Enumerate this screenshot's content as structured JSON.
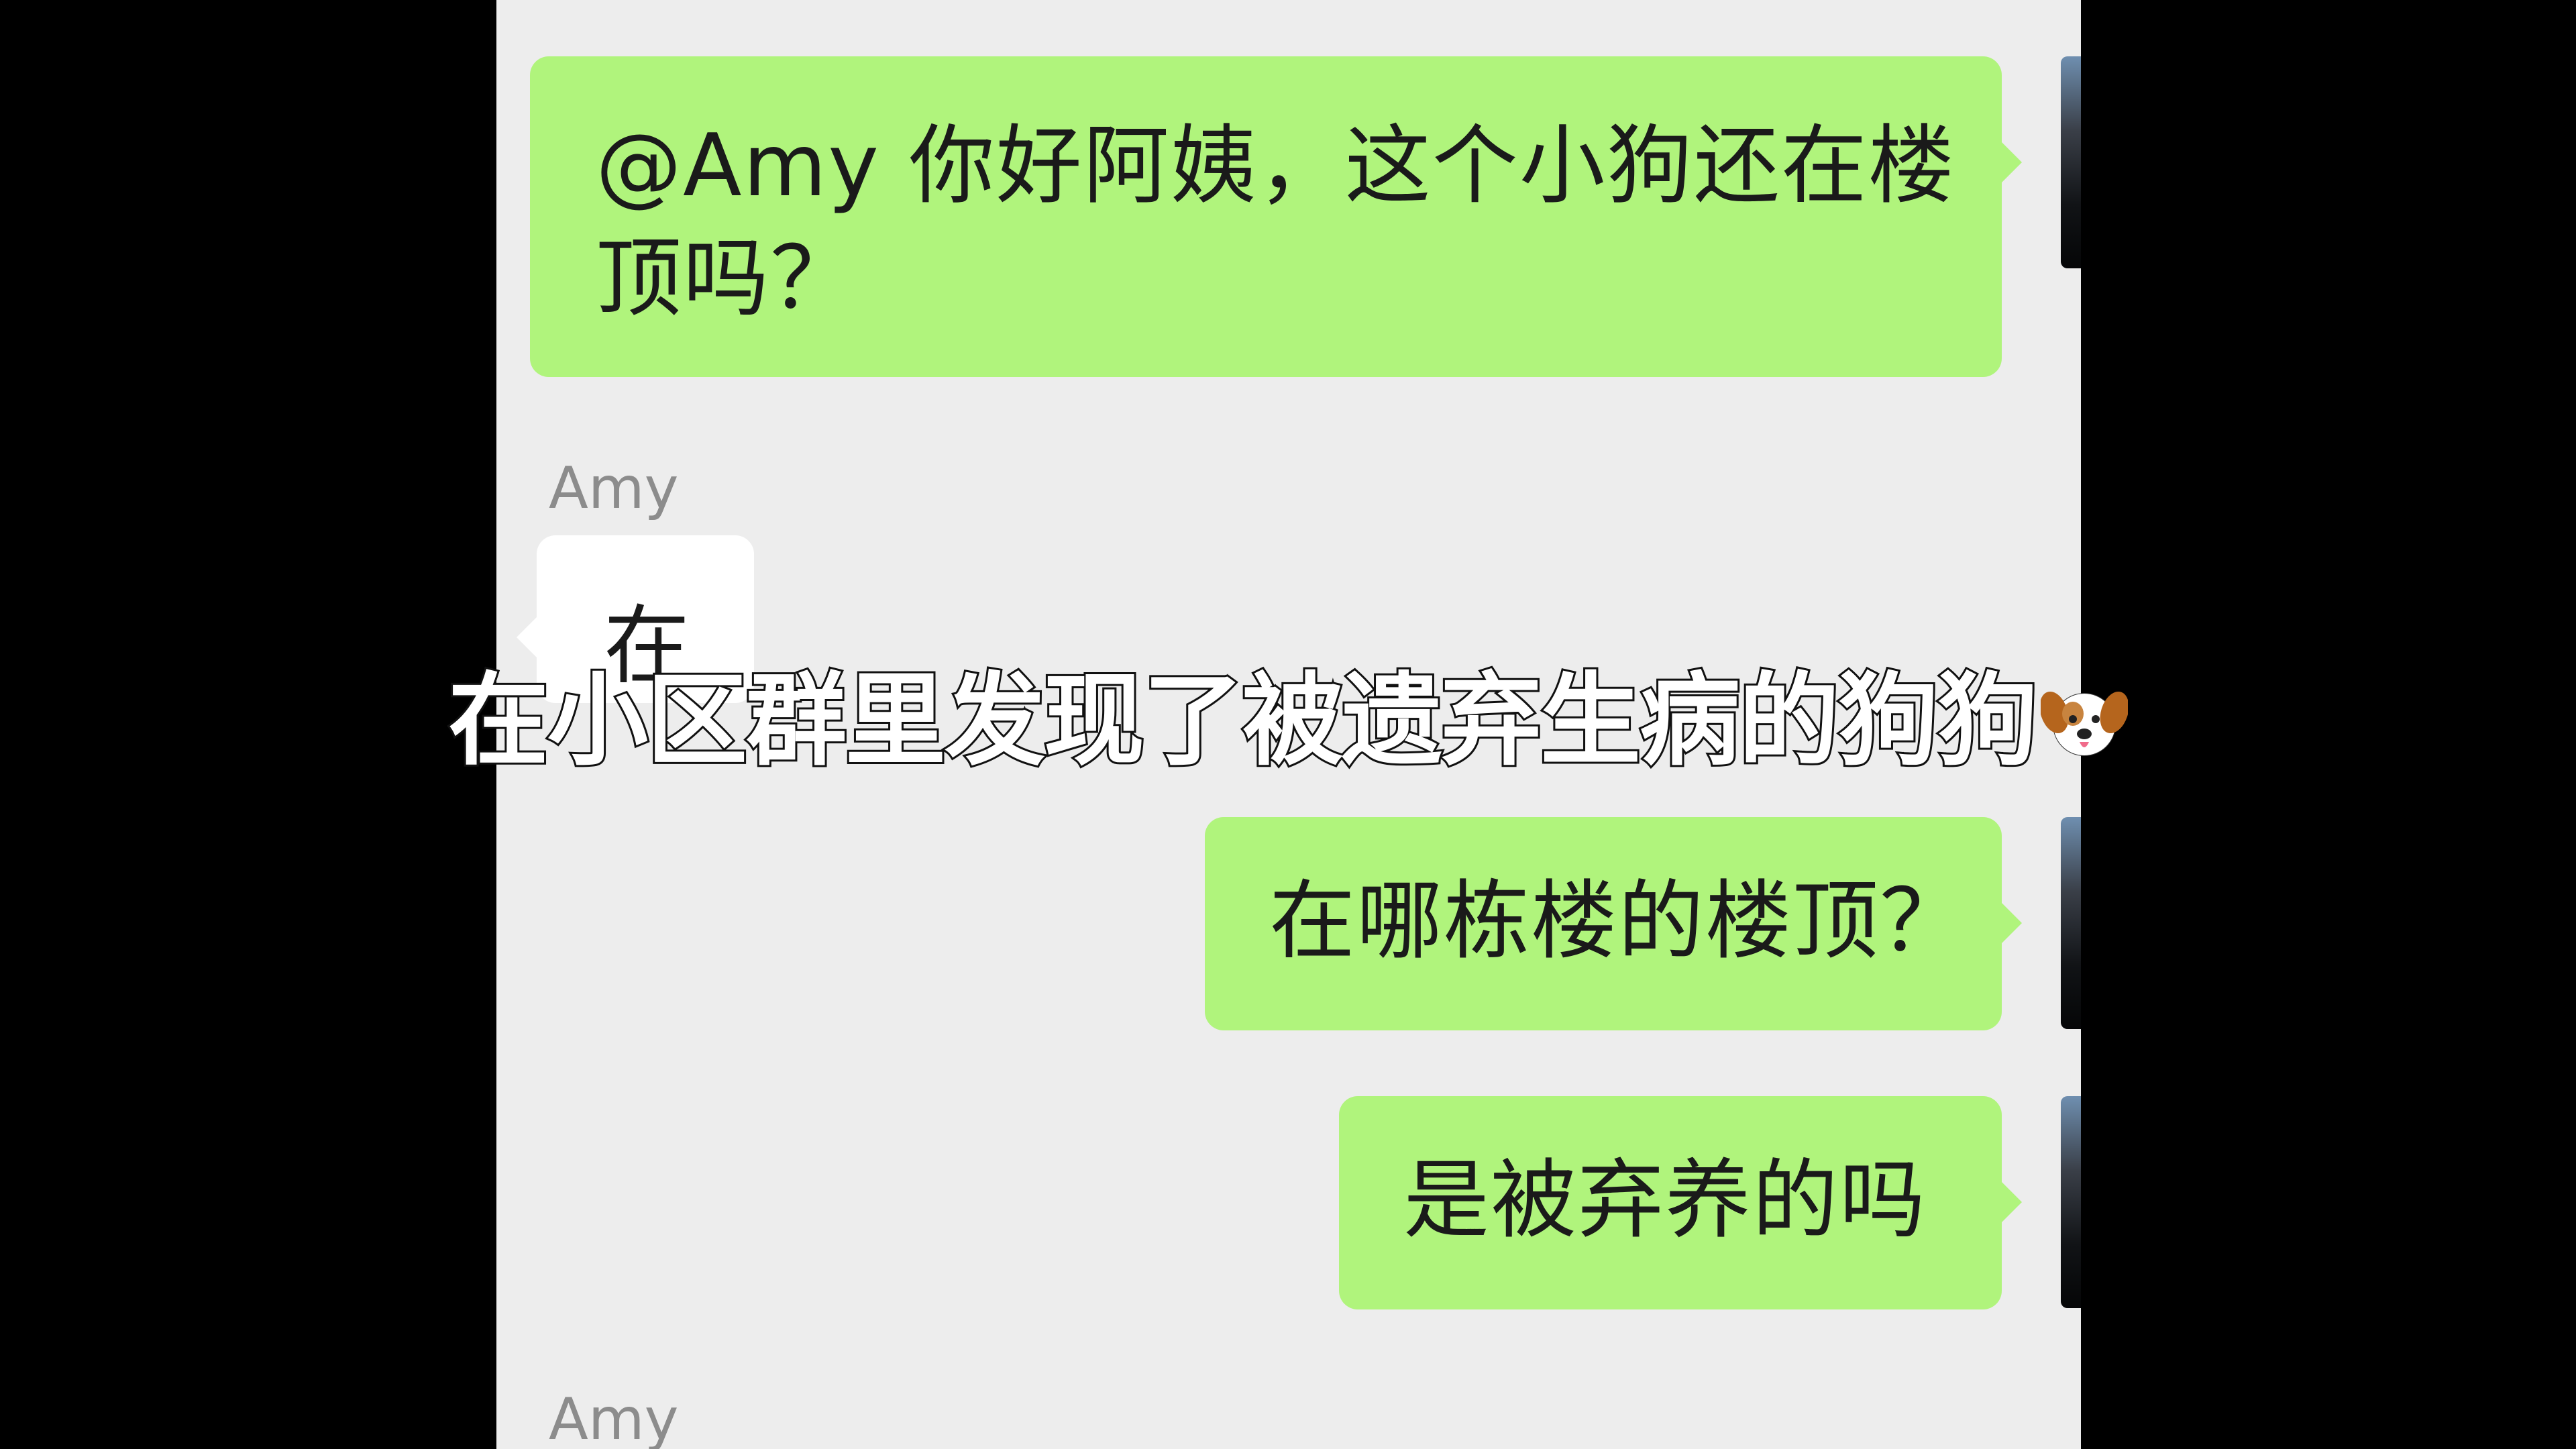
{
  "chat": {
    "messages": [
      {
        "sender": "me",
        "text_line1": "@Amy 你好阿姨，这个小狗还在楼",
        "text_line2": "顶吗？"
      },
      {
        "sender": "Amy",
        "name_label": "Amy",
        "text": "在"
      },
      {
        "sender": "me",
        "text": "在哪栋楼的楼顶？"
      },
      {
        "sender": "me",
        "text": "是被弃养的吗"
      },
      {
        "sender": "Amy",
        "name_label": "Amy"
      }
    ]
  },
  "overlay": {
    "caption": "在小区群里发现了被遗弃生病的狗狗",
    "emoji_icon": "dog-face-icon"
  },
  "colors": {
    "sent_bubble": "#b0f47c",
    "received_bubble": "#ffffff",
    "chat_background": "#ededed",
    "letterbox": "#000000"
  }
}
